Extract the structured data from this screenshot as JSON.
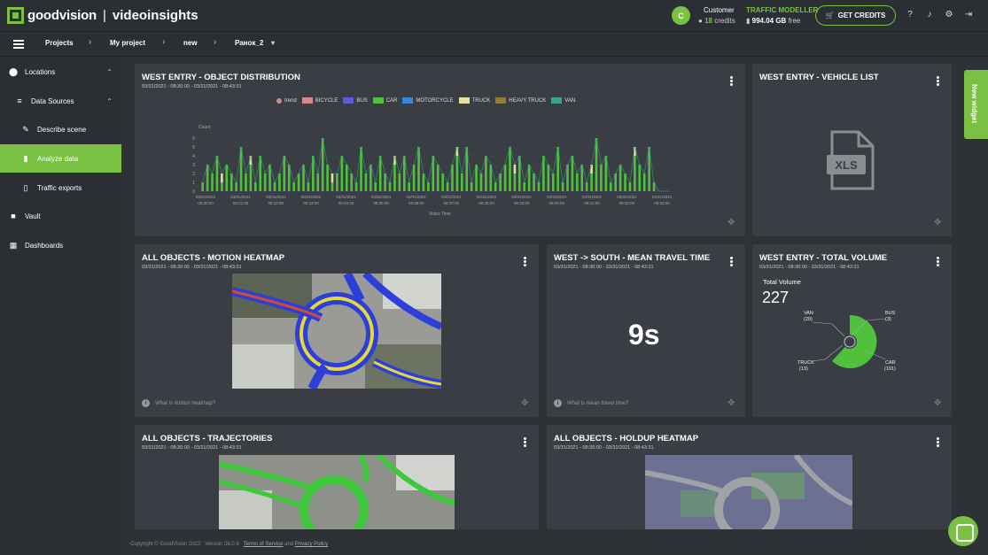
{
  "brand": {
    "name1": "goodvision",
    "sep": "|",
    "name2": "videoinsights"
  },
  "account": {
    "avatar": "C",
    "label": "Customer",
    "credits": "18",
    "credits_label": "credits",
    "plan": "TRAFFIC MODELLER",
    "storage": "994.04 GB",
    "storage_label": "free",
    "get_credits": "GET CREDITS"
  },
  "breadcrumb": [
    "Projects",
    "My project",
    "new",
    "Ранок_2"
  ],
  "sidebar": {
    "items": [
      {
        "label": "Locations",
        "icon": "pin-icon"
      },
      {
        "label": "Data Sources",
        "icon": "stack-icon"
      },
      {
        "label": "Describe scene",
        "icon": "pencil-icon"
      },
      {
        "label": "Analyze data",
        "icon": "chart-icon"
      },
      {
        "label": "Traffic exports",
        "icon": "file-icon"
      },
      {
        "label": "Vault",
        "icon": "lock-icon"
      },
      {
        "label": "Dashboards",
        "icon": "grid-icon"
      }
    ]
  },
  "cards": {
    "distribution": {
      "title": "WEST ENTRY - OBJECT DISTRIBUTION",
      "sub": "03/31/2021 - 08:30:00 - 03/31/2021 - 08:43:31"
    },
    "vehicle_list": {
      "title": "WEST ENTRY - VEHICLE LIST",
      "icon_text": "XLS"
    },
    "heatmap": {
      "title": "ALL OBJECTS - MOTION HEATMAP",
      "sub": "03/31/2021 - 08:30:00 - 03/31/2021 - 08:43:31",
      "help": "What is motion heatmap?"
    },
    "travel": {
      "title": "WEST -> SOUTH - MEAN TRAVEL TIME",
      "sub": "03/31/2021 - 08:30:00 - 03/31/2021 - 08:43:31",
      "value": "9s",
      "help": "What is mean travel time?"
    },
    "volume": {
      "title": "WEST ENTRY - TOTAL VOLUME",
      "sub": "03/31/2021 - 08:30:00 - 03/31/2021 - 08:43:31",
      "label": "Total Volume",
      "value": "227",
      "segments": [
        {
          "name": "VAN",
          "count": "(20)"
        },
        {
          "name": "BUS",
          "count": "(3)"
        },
        {
          "name": "TRUCK",
          "count": "(13)"
        },
        {
          "name": "CAR",
          "count": "(191)"
        }
      ]
    },
    "trajectories": {
      "title": "ALL OBJECTS - TRAJECTORIES",
      "sub": "03/31/2021 - 08:30:00 - 03/31/2021 - 08:43:31"
    },
    "holdup": {
      "title": "ALL OBJECTS - HOLDUP HEATMAP",
      "sub": "03/31/2021 - 08:30:00 - 03/31/2021 - 08:43:31"
    }
  },
  "chart_data": {
    "type": "bar",
    "ylabel": "Count",
    "xlabel": "Video Time",
    "ylim": [
      0,
      6
    ],
    "yticks": [
      "0",
      "1",
      "2",
      "3",
      "4",
      "5",
      "6"
    ],
    "legend": [
      "trend",
      "BICYCLE",
      "BUS",
      "CAR",
      "MOTORCYCLE",
      "TRUCK",
      "HEAVY TRUCK",
      "VAN"
    ],
    "colors": {
      "BICYCLE": "#d78a8a",
      "BUS": "#5b5bd8",
      "CAR": "#4fc13c",
      "MOTORCYCLE": "#3a86d8",
      "TRUCK": "#e8e0a0",
      "HEAVY TRUCK": "#8f7d3a",
      "VAN": "#3aa38a"
    },
    "xticks": [
      "03/31/2021 08:30:00",
      "03/31/2021 08:31:00",
      "03/31/2021 08:32:00",
      "03/31/2021 08:33:00",
      "03/31/2021 08:34:00",
      "03/31/2021 08:35:00",
      "03/31/2021 08:36:00",
      "03/31/2021 08:37:00",
      "03/31/2021 08:38:00",
      "03/31/2021 08:39:00",
      "03/31/2021 08:40:00",
      "03/31/2021 08:41:00",
      "03/31/2021 08:42:00",
      "03/31/2021 08:43:00"
    ],
    "car_values": [
      1,
      3,
      2,
      4,
      1,
      3,
      2,
      1,
      5,
      2,
      3,
      1,
      4,
      2,
      3,
      1,
      2,
      4,
      3,
      1,
      2,
      3,
      1,
      4,
      2,
      6,
      3,
      1,
      2,
      4,
      3,
      2,
      1,
      5,
      2,
      3,
      1,
      4,
      2,
      1,
      3,
      2,
      4,
      1,
      3,
      5,
      2,
      1,
      4,
      3,
      2,
      1,
      3,
      4,
      2,
      5,
      1,
      3,
      2,
      4,
      3,
      1,
      2,
      3,
      5,
      2,
      4,
      1,
      3,
      2,
      1,
      4,
      3,
      2,
      5,
      1,
      3,
      4,
      2,
      3,
      1,
      2,
      6,
      3,
      4,
      1,
      2,
      3,
      2,
      1,
      4,
      3,
      2,
      5,
      1,
      0,
      0,
      0
    ],
    "truck_values": [
      0,
      0,
      0,
      0,
      1,
      0,
      0,
      0,
      0,
      0,
      1,
      0,
      0,
      0,
      0,
      0,
      0,
      0,
      0,
      0,
      0,
      0,
      0,
      0,
      0,
      0,
      0,
      1,
      0,
      0,
      0,
      0,
      0,
      0,
      0,
      0,
      0,
      0,
      0,
      0,
      1,
      0,
      0,
      0,
      0,
      0,
      0,
      0,
      0,
      0,
      0,
      0,
      0,
      1,
      0,
      0,
      0,
      0,
      0,
      0,
      0,
      0,
      0,
      0,
      0,
      1,
      0,
      0,
      0,
      0,
      0,
      0,
      0,
      0,
      0,
      0,
      0,
      0,
      0,
      0,
      0,
      1,
      0,
      0,
      0,
      0,
      0,
      0,
      0,
      0,
      1,
      0,
      0,
      0,
      0,
      0,
      0,
      0
    ]
  },
  "newwidget": "New widget",
  "footer": {
    "copyright": "Copyright © GoodVision 2022",
    "version": "Version 26.0.9",
    "tos": "Terms of Service",
    "and": "and",
    "privacy": "Privacy Policy"
  }
}
